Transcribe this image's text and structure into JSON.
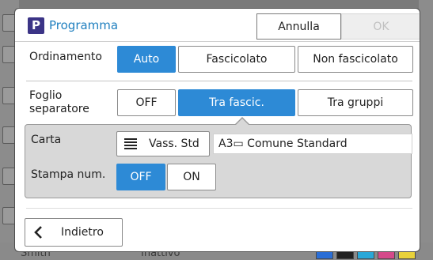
{
  "background": {
    "user": "Smith",
    "status": "Inattivo",
    "toner_colors": [
      "#2a6ed6",
      "#222222",
      "#2aa8d8",
      "#d44a8a",
      "#e8d23a"
    ]
  },
  "dialog": {
    "title": "Programma",
    "cancel_label": "Annulla",
    "ok_label": "OK",
    "logo_letter": "P"
  },
  "sort": {
    "label": "Ordinamento",
    "options": [
      "Auto",
      "Fascicolato",
      "Non fascicolato"
    ],
    "selected": "Auto"
  },
  "separator": {
    "label": "Foglio\nseparatore",
    "options": [
      "OFF",
      "Tra fascic.",
      "Tra gruppi"
    ],
    "selected": "Tra fascic."
  },
  "paper": {
    "label": "Carta",
    "tray_label": "Vass. Std",
    "tray_icon": "paper-tray-icon",
    "value": "A3▭ Comune Standard"
  },
  "print_num": {
    "label": "Stampa num.",
    "options": [
      "OFF",
      "ON"
    ],
    "selected": "OFF"
  },
  "back": {
    "label": "Indietro",
    "icon": "chevron-left-icon"
  },
  "colors": {
    "accent": "#2d8ad6",
    "title": "#1f7fbf",
    "logo": "#3b3486"
  }
}
